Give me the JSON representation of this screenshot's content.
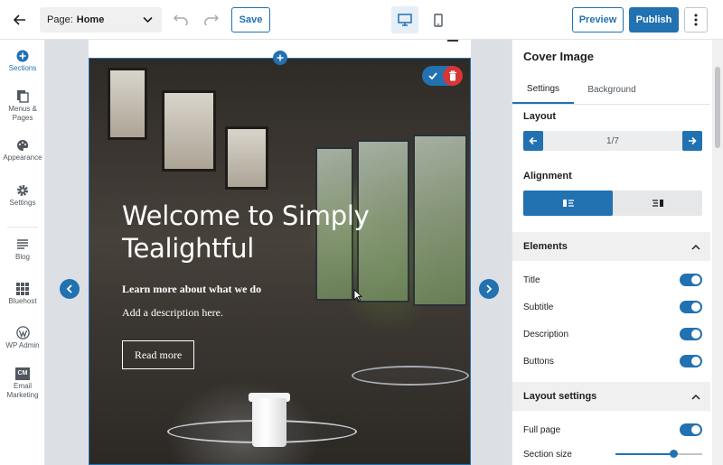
{
  "topbar": {
    "page_label": "Page:",
    "page_value": "Home",
    "save_label": "Save",
    "preview_label": "Preview",
    "publish_label": "Publish"
  },
  "sidebar": {
    "items": [
      {
        "label": "Sections",
        "icon": "plus-circle-icon"
      },
      {
        "label": "Menus & Pages",
        "icon": "pages-icon"
      },
      {
        "label": "Appearance",
        "icon": "palette-icon"
      },
      {
        "label": "Settings",
        "icon": "gear-icon"
      },
      {
        "label": "Blog",
        "icon": "blog-icon"
      },
      {
        "label": "Bluehost",
        "icon": "bluehost-grid-icon"
      },
      {
        "label": "WP Admin",
        "icon": "wordpress-icon"
      },
      {
        "label": "Email Marketing",
        "icon": "cm-icon",
        "badge": "CM"
      }
    ]
  },
  "cover": {
    "title": "Welcome to Simply Tealightful",
    "subtitle": "Learn more about what we do",
    "description": "Add a description here.",
    "button_label": "Read more"
  },
  "panel": {
    "title": "Cover Image",
    "tabs": [
      "Settings",
      "Background"
    ],
    "layout_label": "Layout",
    "layout_value": "1/7",
    "alignment_label": "Alignment",
    "elements_label": "Elements",
    "elements": [
      {
        "label": "Title",
        "on": true
      },
      {
        "label": "Subtitle",
        "on": true
      },
      {
        "label": "Description",
        "on": true
      },
      {
        "label": "Buttons",
        "on": true
      }
    ],
    "layout_settings_label": "Layout settings",
    "full_page_label": "Full page",
    "section_size_label": "Section size",
    "section_size_fraction": 0.67
  },
  "colors": {
    "accent": "#2271b1",
    "danger": "#d63638"
  }
}
